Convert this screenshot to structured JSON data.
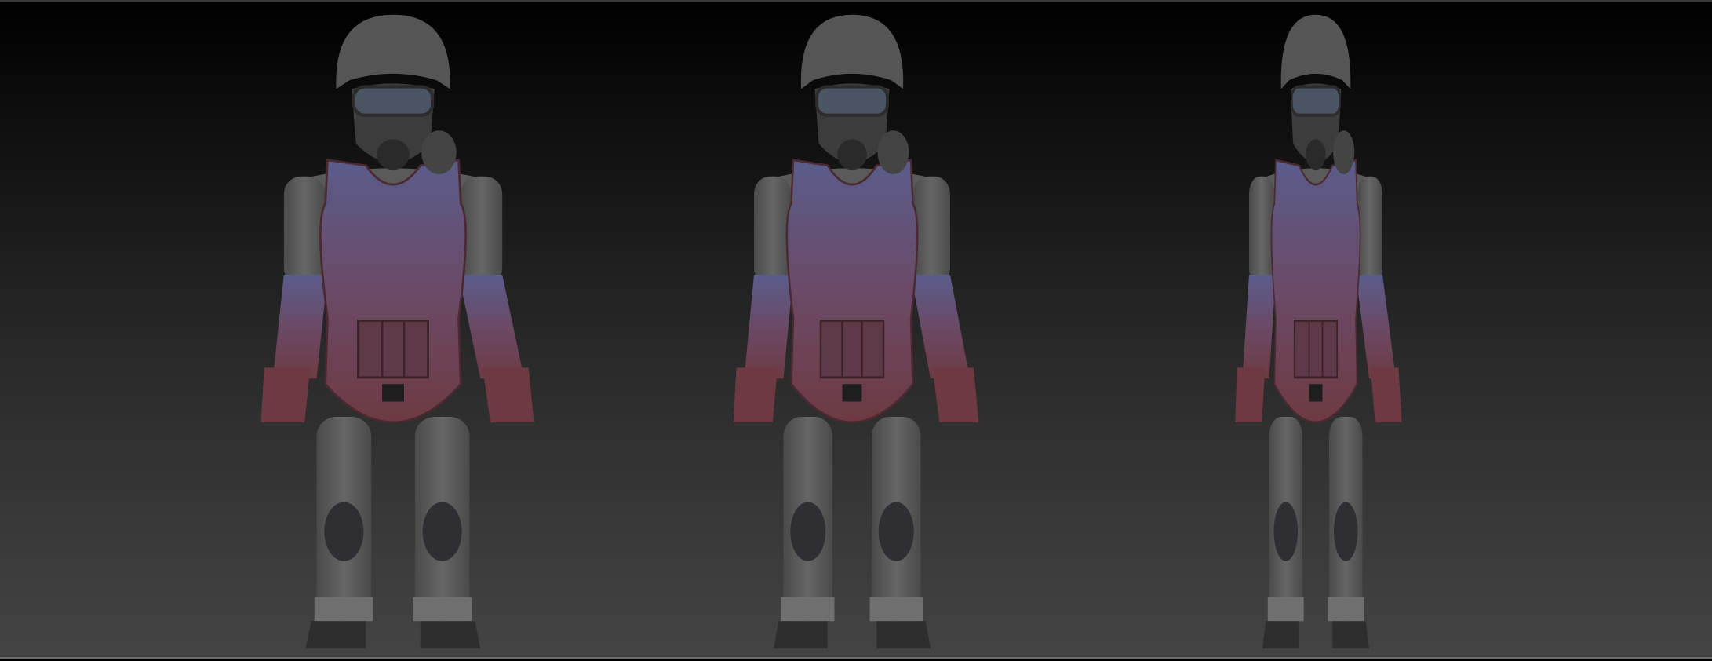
{
  "scene": {
    "views": [
      "front",
      "three-quarter",
      "side"
    ],
    "colors": {
      "background_top": "#000000",
      "background_bottom": "#444444",
      "clay_gray": "#5c5c5c",
      "armor_red": "#6e3a42",
      "armor_blue": "#5a5c8a",
      "boot_dark": "#2e2e2e"
    }
  }
}
